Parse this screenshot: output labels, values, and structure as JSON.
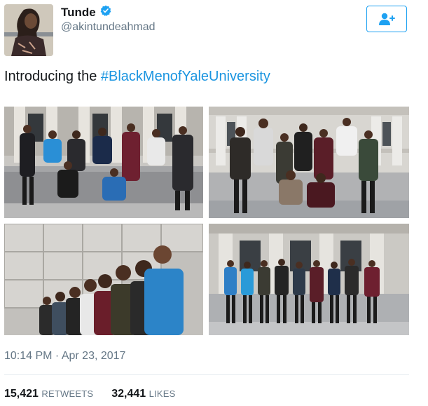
{
  "user": {
    "name": "Tunde",
    "handle": "@akintundeahmad",
    "verified": true
  },
  "follow_button": {
    "icon": "add-user-icon"
  },
  "tweet": {
    "text_prefix": "Introducing the ",
    "hashtag": "#BlackMenofYaleUniversity"
  },
  "photos": [
    {
      "icon": "group-photo-steps"
    },
    {
      "icon": "group-photo-building"
    },
    {
      "icon": "group-photo-diagonal-line"
    },
    {
      "icon": "group-photo-columns"
    }
  ],
  "timestamp": "10:14 PM · Apr 23, 2017",
  "stats": {
    "retweets_count": "15,421",
    "retweets_label": "RETWEETS",
    "likes_count": "32,441",
    "likes_label": "LIKES"
  },
  "colors": {
    "accent": "#1da1f2",
    "hashtag": "#1b95e0",
    "secondary_text": "#657786"
  }
}
